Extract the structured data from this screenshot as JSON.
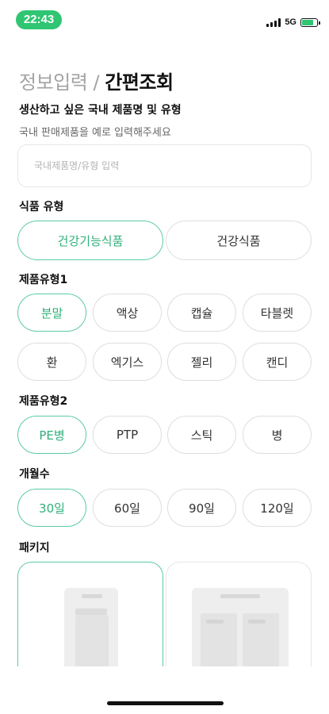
{
  "status": {
    "time": "22:43",
    "network": "5G",
    "battery_level": 0.7
  },
  "header": {
    "title_step": "정보입력",
    "separator": "/",
    "title_active": "간편조회"
  },
  "product_section": {
    "label": "생산하고 싶은 국내 제품명 및 유형",
    "hint": "국내 판매제품을 예로 입력해주세요",
    "input_placeholder": "국내제품명/유형 입력",
    "input_value": ""
  },
  "food_type": {
    "label": "식품 유형",
    "options": [
      "건강기능식품",
      "건강식품"
    ],
    "selected": "건강기능식품"
  },
  "product_type1": {
    "label": "제품유형1",
    "options": [
      "분말",
      "액상",
      "캡슐",
      "타블렛",
      "환",
      "엑기스",
      "젤리",
      "캔디"
    ],
    "selected": "분말"
  },
  "product_type2": {
    "label": "제품유형2",
    "options": [
      "PE병",
      "PTP",
      "스틱",
      "병"
    ],
    "selected": "PE병"
  },
  "months": {
    "label": "개월수",
    "options": [
      "30일",
      "60일",
      "90일",
      "120일"
    ],
    "selected": "30일"
  },
  "package": {
    "label": "패키지",
    "selected_index": 0
  },
  "colors": {
    "accent": "#2fb07a",
    "accent_border": "#5bcba0",
    "time_pill": "#2fc572"
  }
}
